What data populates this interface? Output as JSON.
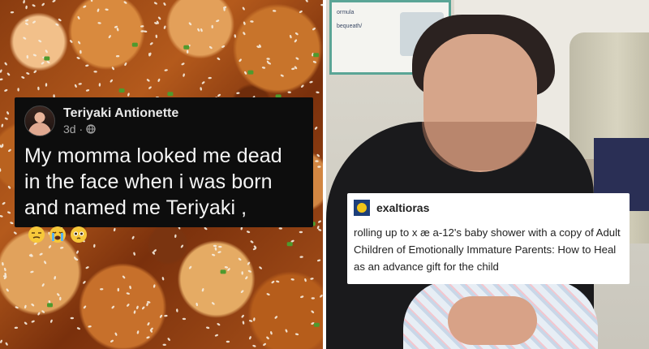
{
  "left_post": {
    "author": "Teriyaki Antionette",
    "meta": "3d ·",
    "text": "My momma looked me dead in the face when i was born and named me Teriyaki ,",
    "emojis": [
      "unamused-face-emoji",
      "loudly-crying-face-emoji",
      "pleading-face-emoji"
    ]
  },
  "right_photo": {
    "poster_line1": "ormula",
    "poster_line2": "bequeath/"
  },
  "right_post": {
    "username": "exaltioras",
    "text": "rolling up to x æ a-12's baby shower with a copy of Adult Children of Emotionally Immature Parents: How to Heal as an advance gift for the child"
  },
  "colors": {
    "tweet_bg": "#0d0d0d",
    "tumblr_bg": "#ffffff",
    "tumblr_avatar": "#1d3f7a"
  }
}
